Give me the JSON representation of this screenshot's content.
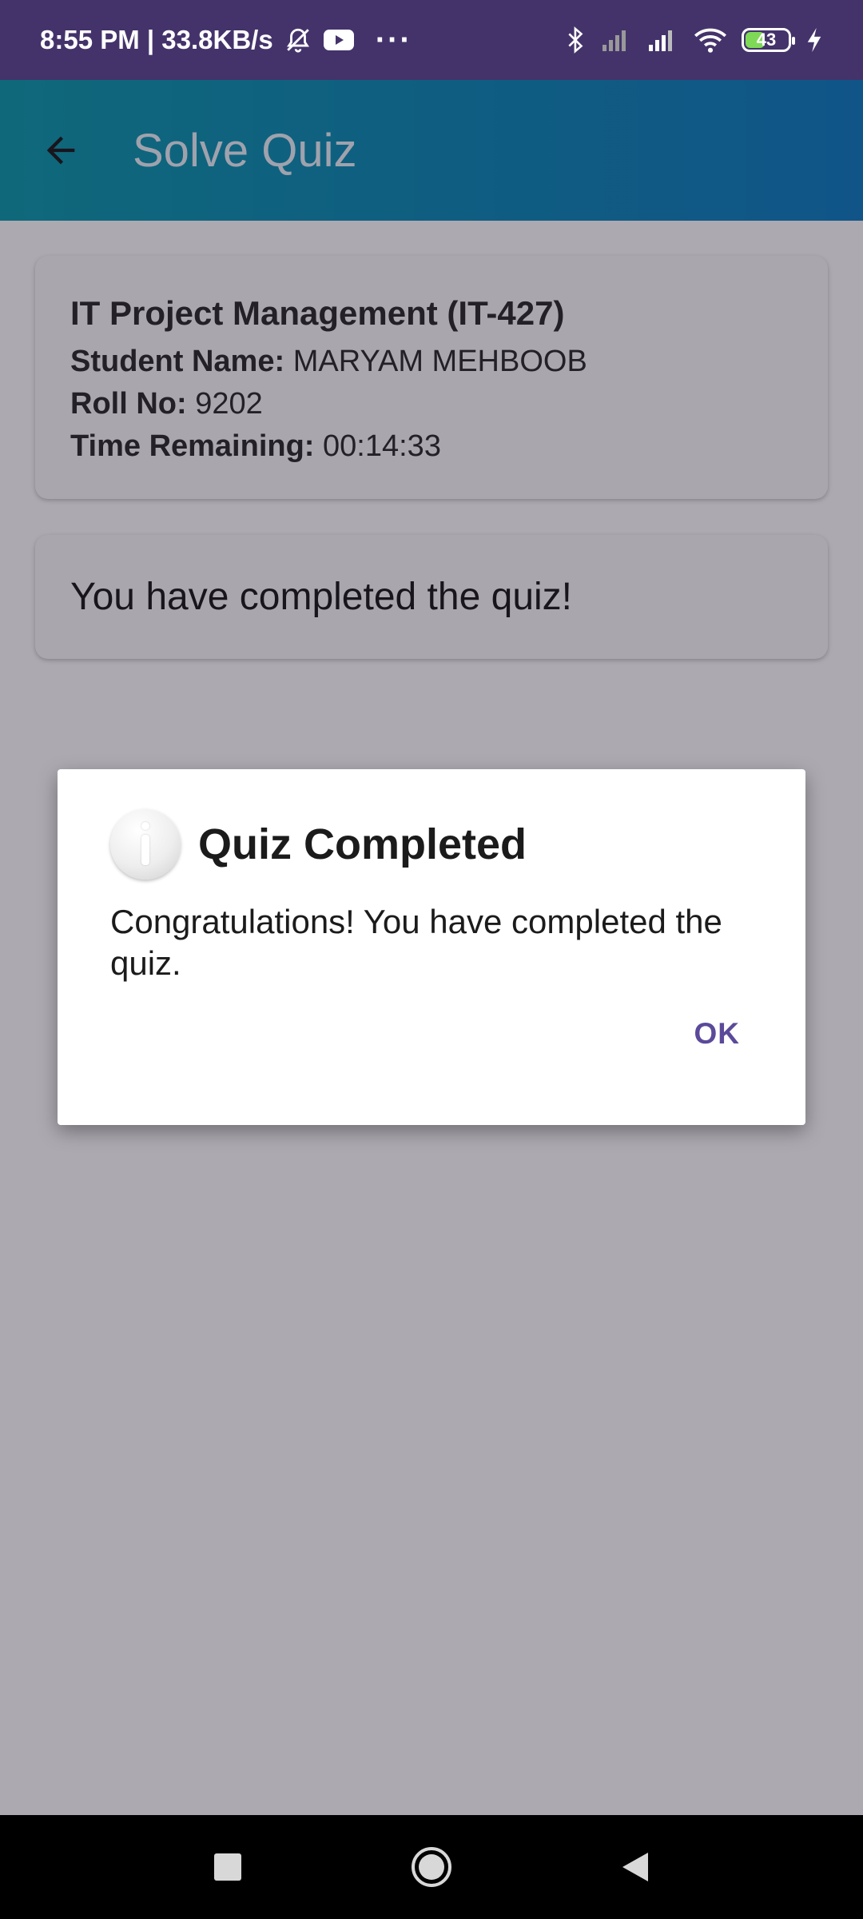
{
  "status_bar": {
    "time_speed": "8:55 PM | 33.8KB/s",
    "more": "···",
    "battery_level": "43",
    "icons": [
      "alarm-off-icon",
      "youtube-icon",
      "bluetooth-icon",
      "signal-icon",
      "wifi-icon",
      "battery-icon",
      "charging-icon"
    ]
  },
  "app_bar": {
    "title": "Solve Quiz",
    "back_icon": "arrow-back-icon"
  },
  "info_card": {
    "course": "IT Project Management (IT-427)",
    "student_label": "Student Name:",
    "student_value": "MARYAM MEHBOOB",
    "roll_label": "Roll No:",
    "roll_value": "9202",
    "time_label": "Time Remaining:",
    "time_value": "00:14:33"
  },
  "status_card": {
    "text": "You have completed the quiz!"
  },
  "dialog": {
    "icon": "info-icon",
    "title": "Quiz Completed",
    "message": "Congratulations! You have completed the quiz.",
    "ok_label": "OK"
  },
  "nav_bar": {
    "icons": [
      "recents-square-icon",
      "home-circle-icon",
      "back-triangle-icon"
    ]
  },
  "colors": {
    "status_bar_bg": "#44336b",
    "app_bar_gradient_start": "#0097a7",
    "app_bar_gradient_end": "#0277bd",
    "dialog_button": "#5b4a9a"
  }
}
